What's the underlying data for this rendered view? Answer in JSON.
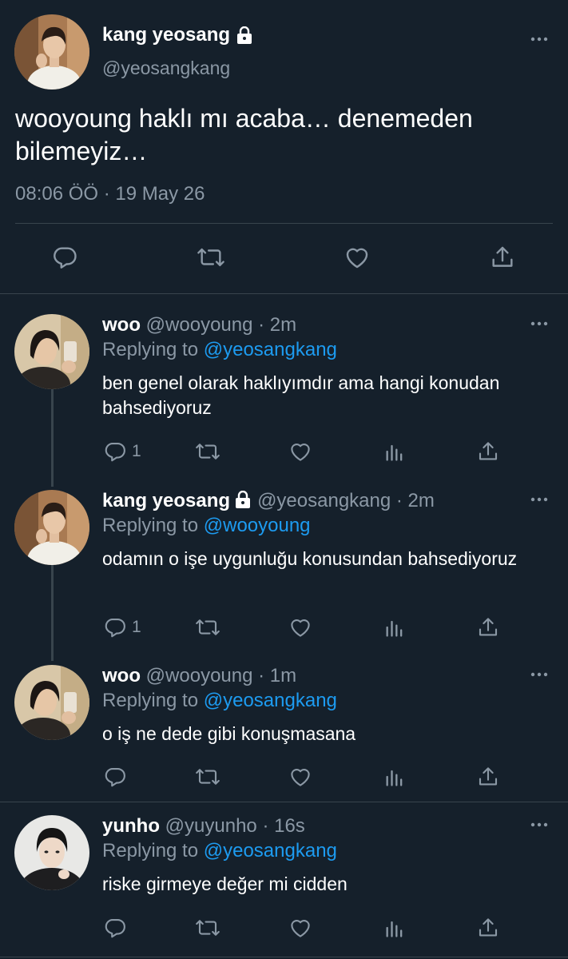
{
  "colors": {
    "background": "#15202b",
    "text": "#ffffff",
    "secondary": "#8b98a5",
    "link": "#1d9bf0",
    "border": "#38444d"
  },
  "main_tweet": {
    "name": "kang yeosang",
    "handle": "@yeosangkang",
    "locked": true,
    "text": "wooyoung haklı mı acaba… denemeden bilemeyiz…",
    "timestamp": "08:06 ÖÖ · 19 May 26",
    "actions": [
      "reply-icon",
      "retweet-icon",
      "like-icon",
      "share-icon"
    ]
  },
  "replies": [
    {
      "name": "woo",
      "handle": "@wooyoung",
      "time": "· 2m",
      "locked": false,
      "replying_label": "Replying to",
      "replying_to": "@yeosangkang",
      "text": "ben genel olarak haklıyımdır ama hangi konudan bahsediyoruz",
      "reply_count": "1"
    },
    {
      "name": "kang yeosang",
      "handle": "@yeosangkang",
      "time": "· 2m",
      "locked": true,
      "replying_label": "Replying to",
      "replying_to": "@wooyoung",
      "text": "odamın o işe uygunluğu konusundan bahsediyoruz",
      "reply_count": "1"
    },
    {
      "name": "woo",
      "handle": "@wooyoung",
      "time": "· 1m",
      "locked": false,
      "replying_label": "Replying to",
      "replying_to": "@yeosangkang",
      "text": "o iş ne dede gibi konuşmasana",
      "reply_count": ""
    },
    {
      "name": "yunho",
      "handle": "@yuyunho",
      "time": "· 16s",
      "locked": false,
      "replying_label": "Replying to",
      "replying_to": "@yeosangkang",
      "text": "riske girmeye değer mi cidden",
      "reply_count": ""
    }
  ]
}
